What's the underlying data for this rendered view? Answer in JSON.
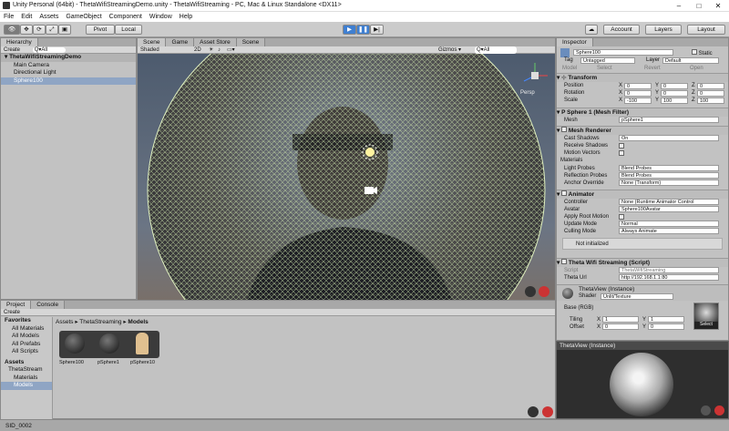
{
  "window": {
    "title": "Unity Personal (64bit) - ThetaWifiStreamingDemo.unity - ThetaWifiStreaming - PC, Mac & Linux Standalone <DX11>",
    "minimize": "–",
    "maximize": "□",
    "close": "✕"
  },
  "menu": [
    "File",
    "Edit",
    "Assets",
    "GameObject",
    "Component",
    "Window",
    "Help"
  ],
  "toolbar": {
    "pivot": "Pivot",
    "local": "Local",
    "play": "▶",
    "pause": "❚❚",
    "step": "▶|",
    "account": "Account",
    "layers": "Layers",
    "layout": "Layout"
  },
  "hierarchy": {
    "tab": "Hierarchy",
    "create": "Create",
    "search": "Q▾All",
    "scene": "ThetaWifiStreamingDemo",
    "items": [
      "Main Camera",
      "Directional Light",
      "Sphere100"
    ]
  },
  "scene_tabs": [
    "Scene",
    "Game",
    "Asset Store",
    "Scene"
  ],
  "scene_bar": {
    "shading": "Shaded",
    "mode2d": "2D",
    "gizmos": "Gizmos ▾",
    "search": "Q▾All",
    "persp": "Persp"
  },
  "project": {
    "tabs": [
      "Project",
      "Console"
    ],
    "create": "Create",
    "favorites": "Favorites",
    "fav_items": [
      "All Materials",
      "All Models",
      "All Prefabs",
      "All Scripts"
    ],
    "assets": "Assets",
    "tree": [
      "ThetaStream",
      "Materials",
      "Models"
    ],
    "breadcrumb": [
      "Assets",
      "ThetaStreaming",
      "Models"
    ],
    "files": [
      "Sphere100",
      "pSphere1",
      "pSphere10"
    ]
  },
  "inspector": {
    "tab": "Inspector",
    "name": "Sphere100",
    "static": "Static",
    "tag_label": "Tag",
    "tag": "Untagged",
    "layer_label": "Layer",
    "layer": "Default",
    "prefab": {
      "model": "Model",
      "select": "Select",
      "revert": "Revert",
      "open": "Open"
    },
    "transform": {
      "title": "Transform",
      "position": "Position",
      "rotation": "Rotation",
      "scale": "Scale",
      "pos": [
        "0",
        "0",
        "0"
      ],
      "rot": [
        "0",
        "0",
        "0"
      ],
      "scl": [
        "-100",
        "100",
        "100"
      ],
      "axes": [
        "X",
        "Y",
        "Z"
      ]
    },
    "mesh_filter": {
      "title": "P Sphere 1 (Mesh Filter)",
      "mesh_label": "Mesh",
      "mesh": "pSphere1"
    },
    "renderer": {
      "title": "Mesh Renderer",
      "rows": [
        [
          "Cast Shadows",
          "On"
        ],
        [
          "Receive Shadows",
          ""
        ],
        [
          "Motion Vectors",
          ""
        ],
        [
          "Materials",
          ""
        ],
        [
          "Light Probes",
          "Blend Probes"
        ],
        [
          "Reflection Probes",
          "Blend Probes"
        ],
        [
          "Anchor Override",
          "None (Transform)"
        ]
      ]
    },
    "animator": {
      "title": "Animator",
      "rows": [
        [
          "Controller",
          "None (Runtime Animator Control"
        ],
        [
          "Avatar",
          "Sphere100Avatar"
        ],
        [
          "Apply Root Motion",
          ""
        ],
        [
          "Update Mode",
          "Normal"
        ],
        [
          "Culling Mode",
          "Always Animate"
        ]
      ],
      "note": "Not initialized"
    },
    "script": {
      "title": "Theta Wifi Streaming (Script)",
      "script_label": "Script",
      "script": "ThetaWifiStreaming",
      "url_label": "Theta Url",
      "url": "http://192.168.1.1:80"
    },
    "material": {
      "title": "ThetaView (Instance)",
      "shader_label": "Shader",
      "shader": "Unlit/Texture",
      "base": "Base (RGB)",
      "tiling": "Tiling",
      "offset": "Offset",
      "tx": "1",
      "ty": "1",
      "ox": "0",
      "oy": "0",
      "select": "Select"
    },
    "preview": "ThetaView (Instance)"
  },
  "status": {
    "text": "SID_0002"
  }
}
